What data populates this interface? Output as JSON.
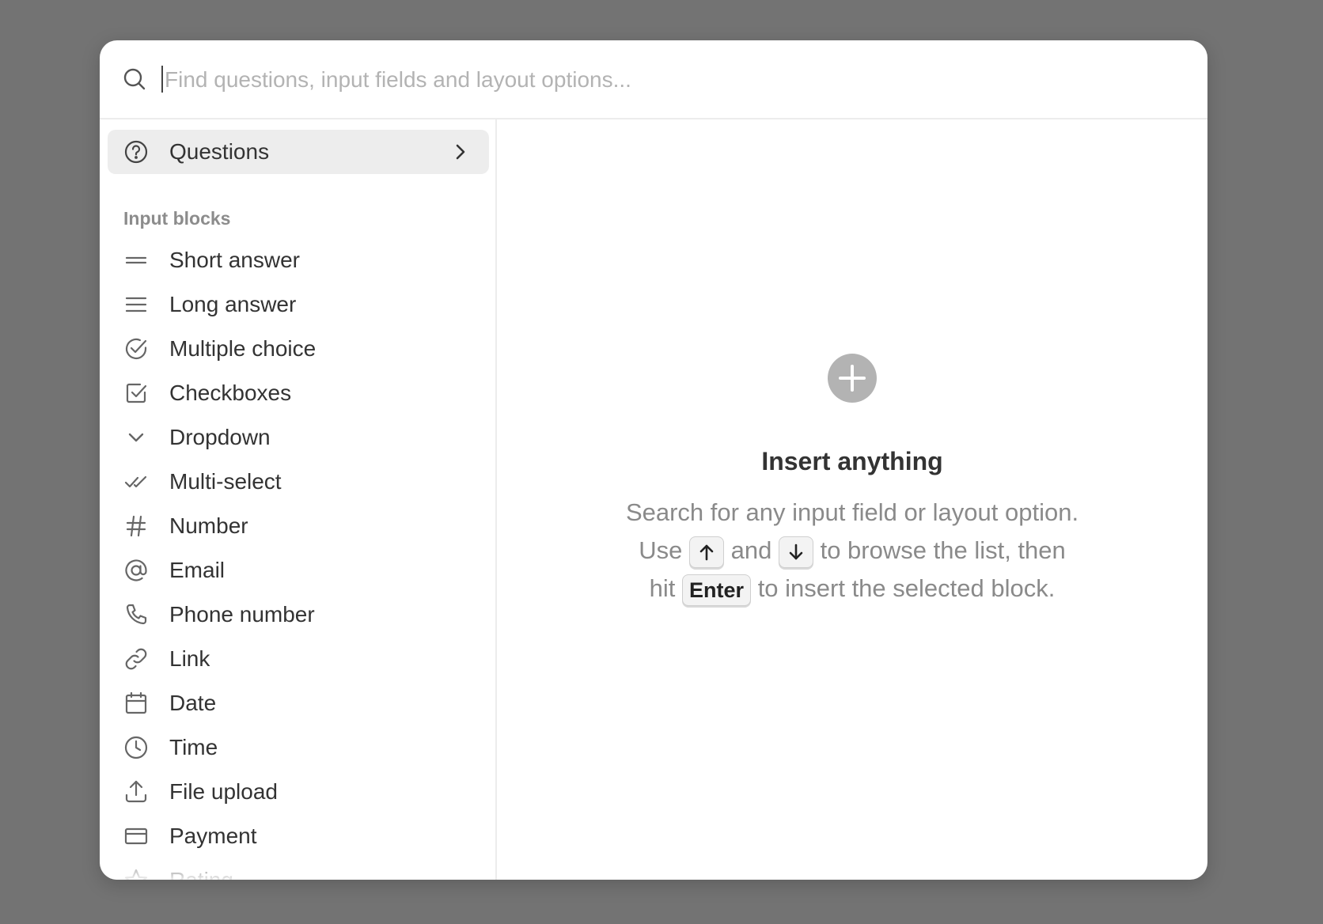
{
  "search": {
    "placeholder": "Find questions, input fields and layout options...",
    "value": ""
  },
  "sidebar": {
    "questions_label": "Questions",
    "section_heading": "Input blocks",
    "items": [
      {
        "label": "Short answer",
        "icon": "short-answer-icon"
      },
      {
        "label": "Long answer",
        "icon": "long-answer-icon"
      },
      {
        "label": "Multiple choice",
        "icon": "check-circle-icon"
      },
      {
        "label": "Checkboxes",
        "icon": "checkbox-icon"
      },
      {
        "label": "Dropdown",
        "icon": "chevron-down-icon"
      },
      {
        "label": "Multi-select",
        "icon": "double-check-icon"
      },
      {
        "label": "Number",
        "icon": "hash-icon"
      },
      {
        "label": "Email",
        "icon": "at-icon"
      },
      {
        "label": "Phone number",
        "icon": "phone-icon"
      },
      {
        "label": "Link",
        "icon": "link-icon"
      },
      {
        "label": "Date",
        "icon": "calendar-icon"
      },
      {
        "label": "Time",
        "icon": "clock-icon"
      },
      {
        "label": "File upload",
        "icon": "upload-icon"
      },
      {
        "label": "Payment",
        "icon": "credit-card-icon"
      },
      {
        "label": "Rating",
        "icon": "star-icon"
      }
    ]
  },
  "main": {
    "title": "Insert anything",
    "desc_part1": "Search for any input field or layout option. Use",
    "desc_and": "and",
    "desc_part2": "to browse the list, then hit",
    "key_enter": "Enter",
    "desc_part3": "to insert the selected block."
  },
  "colors": {
    "backdrop": "#737373",
    "highlight": "#ededed",
    "muted_text": "#8a8a8a",
    "icon_gray": "#b3b3b3"
  }
}
